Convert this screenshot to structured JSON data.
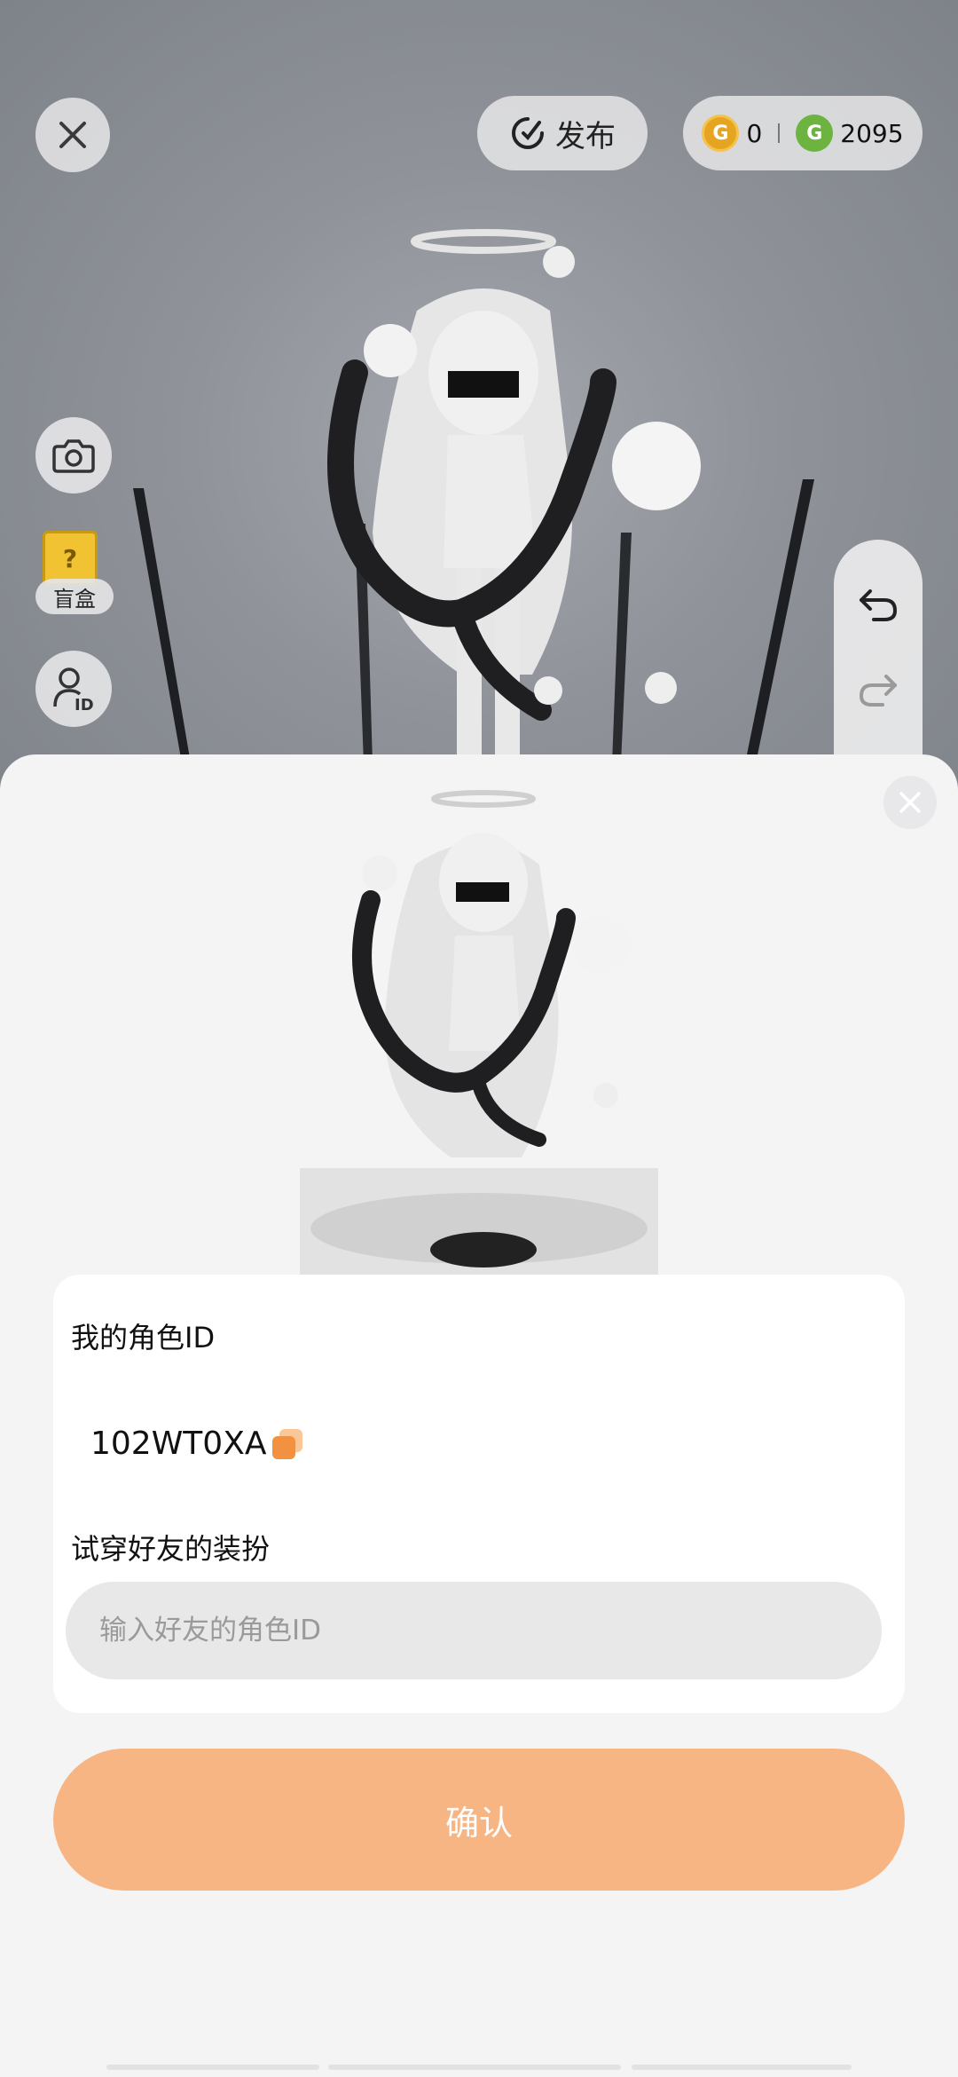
{
  "header": {
    "publish_label": "发布",
    "coin_gold_value": "0",
    "coin_green_value": "2095"
  },
  "side": {
    "blindbox_label": "盲盒"
  },
  "sheet": {
    "my_id_label": "我的角色ID",
    "my_id_value": "102WT0XA",
    "try_on_label": "试穿好友的装扮",
    "friend_id_placeholder": "输入好友的角色ID",
    "friend_id_value": "",
    "confirm_label": "确认"
  },
  "colors": {
    "accent": "#f8b584",
    "gold": "#e6a520",
    "green": "#6db33f"
  },
  "icons": {
    "close": "close-icon",
    "publish": "publish-icon",
    "camera": "camera-icon",
    "blindbox": "blindbox-icon",
    "id": "character-id-icon",
    "undo": "undo-icon",
    "redo": "redo-icon",
    "copy": "copy-icon"
  }
}
